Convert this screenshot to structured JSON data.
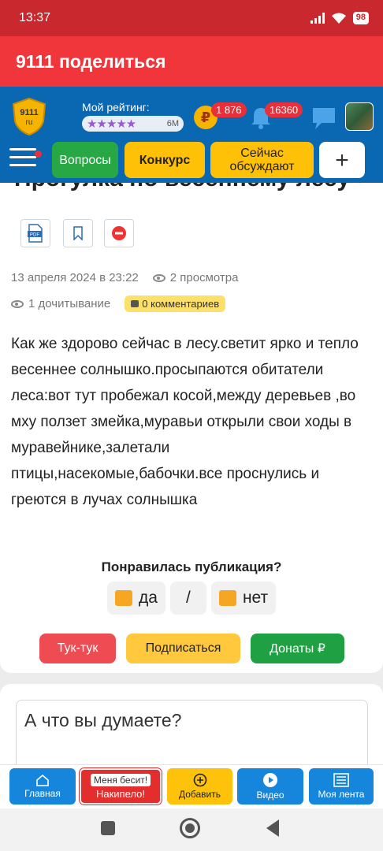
{
  "status_bar": {
    "time": "13:37",
    "battery": "98"
  },
  "app_bar": {
    "title": "9111 поделиться"
  },
  "header": {
    "logo_text": "9111",
    "logo_sub": "ru",
    "rating_label": "Мой рейтинг:",
    "rating_stars": "★★★★★",
    "rating_count": "6M",
    "coins_badge": "1 876",
    "notifications_badge": "16360",
    "coin_symbol": "₽"
  },
  "nav": {
    "questions": "Вопросы",
    "contest": "Конкурс",
    "discussed": "Сейчас обсуждают",
    "plus": "+"
  },
  "post": {
    "title_partial": "Прогулка по весеннему лесу",
    "date": "13 апреля 2024 в 23:22",
    "views": "2 просмотра",
    "reads": "1 дочитывание",
    "comments": "0 комментариев",
    "body": "Как же здорово сейчас в лесу.светит ярко и тепло весеннее солнышко.просыпаются обитатели леса:вот тут пробежал косой,между деревьев ,во мху ползет змейка,муравьи открыли свои ходы в муравейнике,залетали птицы,насекомые,бабочки.все проснулись и греются в лучах солнышка",
    "like_question": "Понравилась публикация?",
    "vote_yes": "да",
    "vote_sep": "/",
    "vote_no": "нет",
    "knock": "Тук-тук",
    "subscribe": "Подписаться",
    "donate": "Донаты ₽"
  },
  "comment": {
    "placeholder": "А что вы думаете?"
  },
  "bottom_nav": {
    "home": "Главная",
    "angry_top": "Меня бесит!",
    "angry_bottom": "Накипело!",
    "add": "Добавить",
    "video": "Видео",
    "feed": "Моя лента"
  },
  "colors": {
    "status_bar": "#c8282e",
    "app_bar": "#f0353b",
    "header": "#0a67b2",
    "accent_yellow": "#ffc107",
    "green": "#28a745"
  }
}
